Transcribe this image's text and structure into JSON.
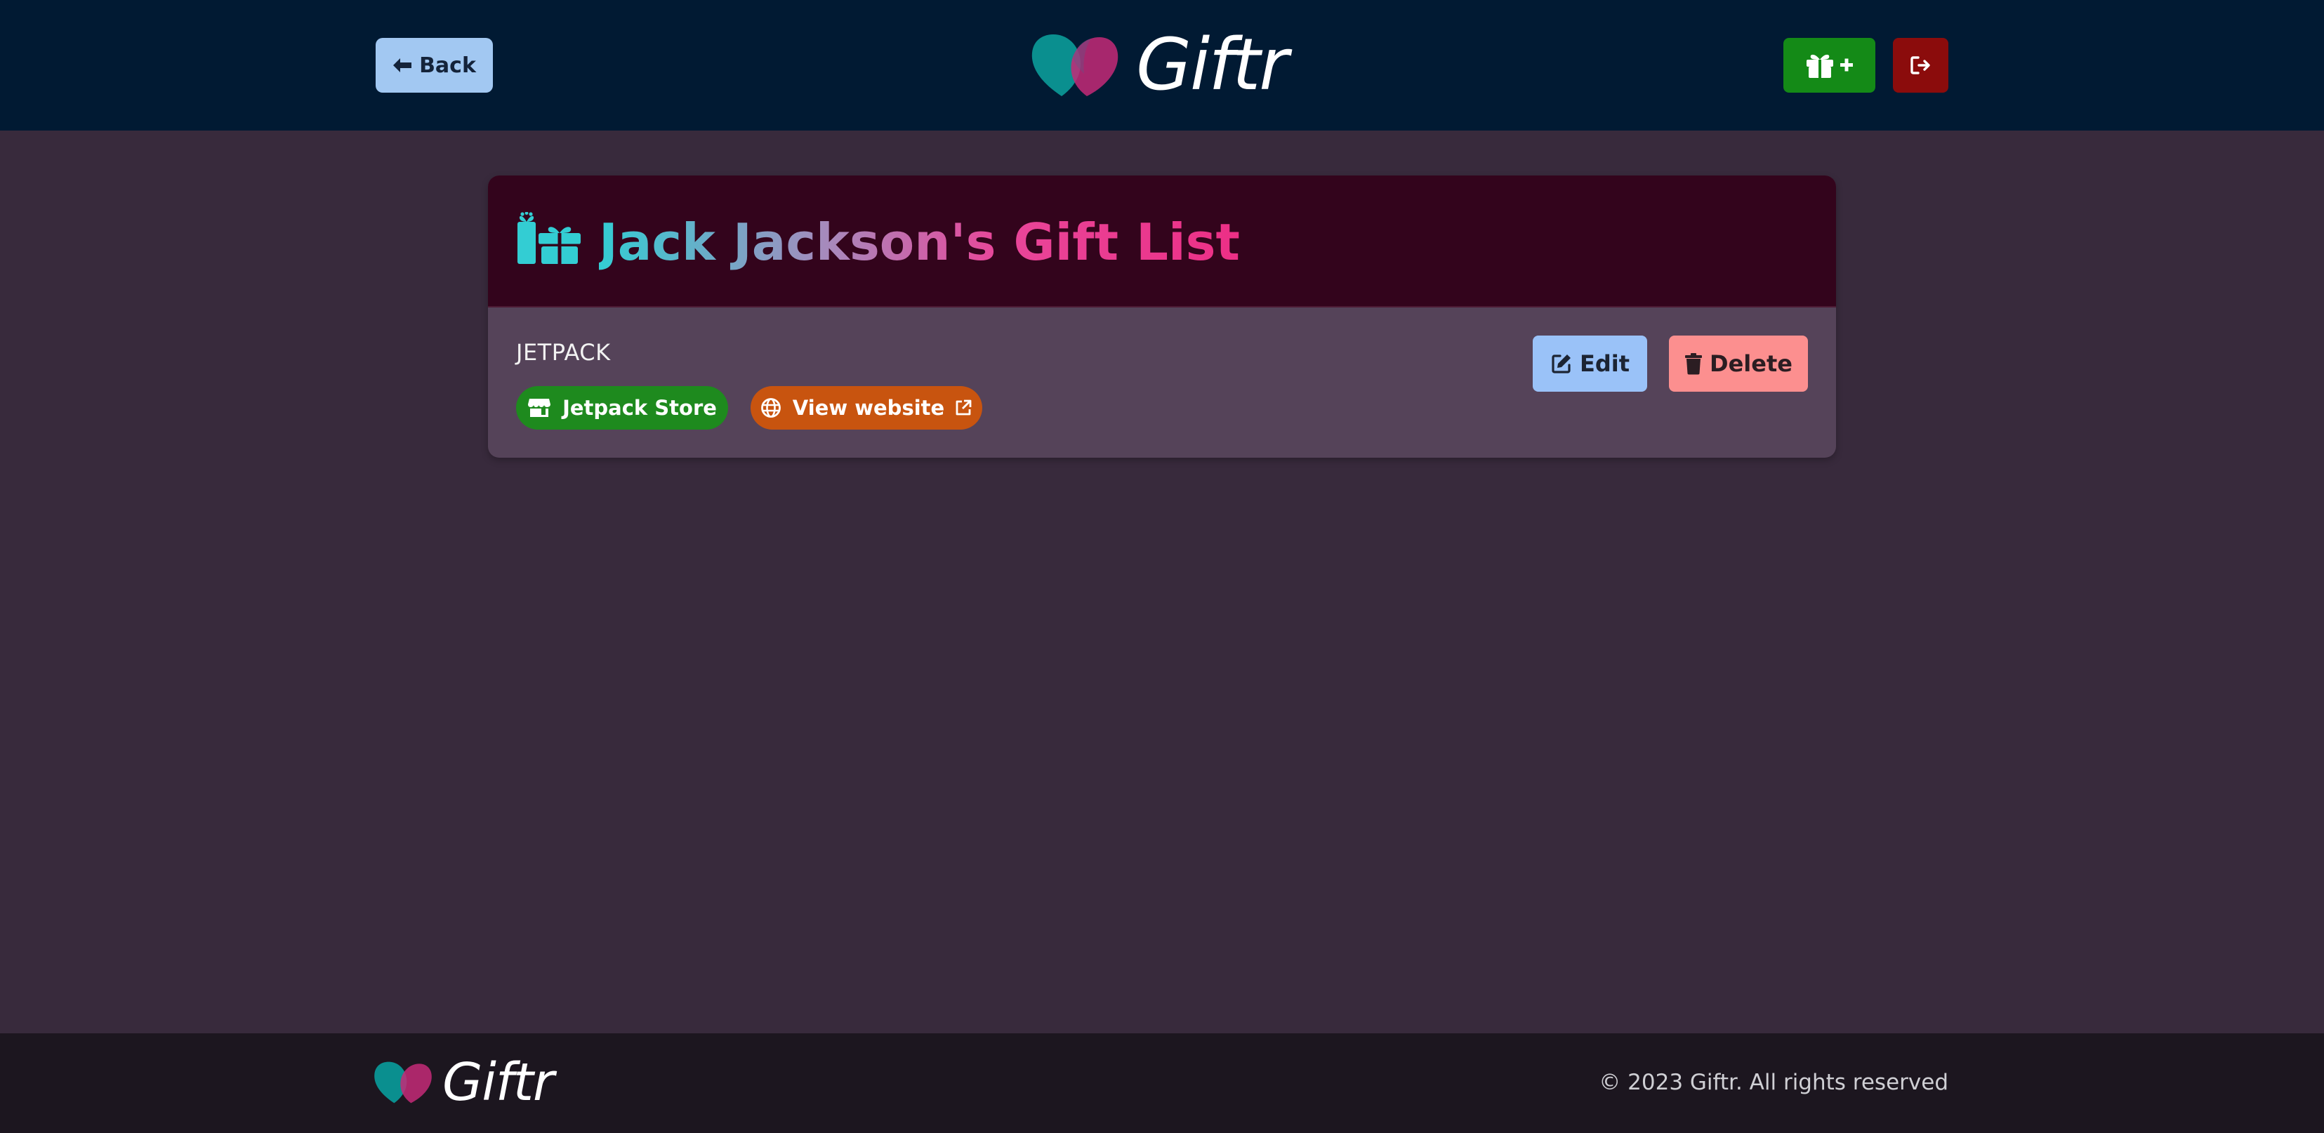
{
  "header": {
    "back_label": "Back",
    "brand": "Giftr"
  },
  "card": {
    "title": "Jack Jackson's Gift List",
    "gift": {
      "name": "JETPACK",
      "store_label": "Jetpack Store",
      "website_label": "View website"
    },
    "edit_label": "Edit",
    "delete_label": "Delete"
  },
  "footer": {
    "brand": "Giftr",
    "copyright": "© 2023 Giftr. All rights reserved"
  },
  "colors": {
    "header_bg": "#011a33",
    "page_bg": "#382a3c",
    "back_button": "#a2c8f2",
    "add_button": "#148a17",
    "logout_button": "#8b0c0c",
    "store_tag": "#1e8a1e",
    "website_tag": "#c8540f",
    "edit_button": "#9ac2f8",
    "delete_button": "#fc8f8f"
  },
  "icons": {
    "back": "arrow-left-icon",
    "add_gift": "gift-plus-icon",
    "logout": "sign-out-icon",
    "title": "gifts-icon",
    "store": "store-icon",
    "website": "globe-icon",
    "external": "external-link-icon",
    "edit": "edit-icon",
    "delete": "trash-icon"
  }
}
